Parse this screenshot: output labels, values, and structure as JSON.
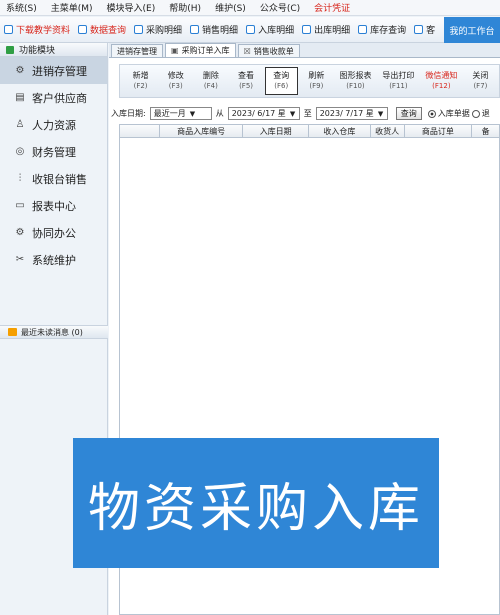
{
  "menubar": {
    "items": [
      "系统(S)",
      "主菜单(M)",
      "模块导入(E)",
      "帮助(H)",
      "维护(S)",
      "公众号(C)",
      "会计凭证"
    ]
  },
  "quickbar": {
    "items": [
      "下载教学资料",
      "数据查询",
      "采购明细",
      "销售明细",
      "入库明细",
      "出库明细",
      "库存查询",
      "客"
    ],
    "workbench": "我的工作台"
  },
  "sidebar": {
    "header": "功能模块",
    "items": [
      {
        "label": "进销存管理",
        "icon": "gear-icon"
      },
      {
        "label": "客户供应商",
        "icon": "document-icon"
      },
      {
        "label": "人力资源",
        "icon": "person-icon"
      },
      {
        "label": "财务管理",
        "icon": "money-icon"
      },
      {
        "label": "收银台销售",
        "icon": "chart-icon"
      },
      {
        "label": "报表中心",
        "icon": "monitor-icon"
      },
      {
        "label": "协同办公",
        "icon": "gear-icon"
      },
      {
        "label": "系统维护",
        "icon": "tools-icon"
      }
    ],
    "footer": "最近未读消息 (0)"
  },
  "tabs": [
    "进销存管理",
    "采购订单入库",
    "销售收款单"
  ],
  "toolbar": [
    {
      "label": "新增",
      "key": "(F2)"
    },
    {
      "label": "修改",
      "key": "(F3)"
    },
    {
      "label": "删除",
      "key": "(F4)"
    },
    {
      "label": "查看",
      "key": "(F5)"
    },
    {
      "label": "查询",
      "key": "(F6)"
    },
    {
      "label": "刷新",
      "key": "(F9)"
    },
    {
      "label": "图形报表",
      "key": "(F10)"
    },
    {
      "label": "导出打印",
      "key": "(F11)"
    },
    {
      "label": "微信通知",
      "key": "(F12)"
    },
    {
      "label": "关闭",
      "key": "(F7)"
    }
  ],
  "filter": {
    "label": "入库日期:",
    "period": "最近一月",
    "from_label": "从",
    "date_from": "2023/ 6/17 星",
    "to_label": "至",
    "date_to": "2023/ 7/17 星",
    "query_button": "查询",
    "radio1": "入库单据",
    "radio2": "退"
  },
  "grid": {
    "columns": [
      "",
      "商品入库编号",
      "入库日期",
      "收入仓库",
      "收货人",
      "商品订单",
      "备"
    ]
  },
  "banner": {
    "text": "物资采购入库"
  },
  "colors": {
    "accent": "#2f86d6",
    "danger": "#d8261c"
  }
}
